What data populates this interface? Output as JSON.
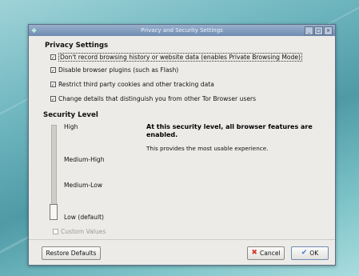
{
  "window": {
    "title": "Privacy and Security Settings"
  },
  "privacy": {
    "heading": "Privacy Settings",
    "options": [
      {
        "label": "Don't record browsing history or website data (enables Private Browsing Mode)",
        "checked": true
      },
      {
        "label": "Disable browser plugins (such as Flash)",
        "checked": true
      },
      {
        "label": "Restrict third party cookies and other tracking data",
        "checked": true
      },
      {
        "label": "Change details that distinguish you from other Tor Browser users",
        "checked": true
      }
    ]
  },
  "security": {
    "heading": "Security Level",
    "levels": [
      "High",
      "Medium-High",
      "Medium-Low",
      "Low (default)"
    ],
    "selected_level": "Low (default)",
    "info_heading": "At this security level, all browser features are enabled.",
    "info_desc": "This provides the most usable experience.",
    "custom_values_label": "Custom Values",
    "custom_values_checked": false
  },
  "buttons": {
    "restore_defaults": "Restore Defaults",
    "cancel": "Cancel",
    "ok": "OK"
  },
  "icons": {
    "cancel": "cancel-icon",
    "ok": "ok-check-icon",
    "app": "app-icon"
  },
  "colors": {
    "titlebar": "#6f8bb2",
    "dialog_bg": "#ecebe8",
    "cancel_icon": "#d9382b",
    "ok_icon": "#3a7fd0"
  }
}
